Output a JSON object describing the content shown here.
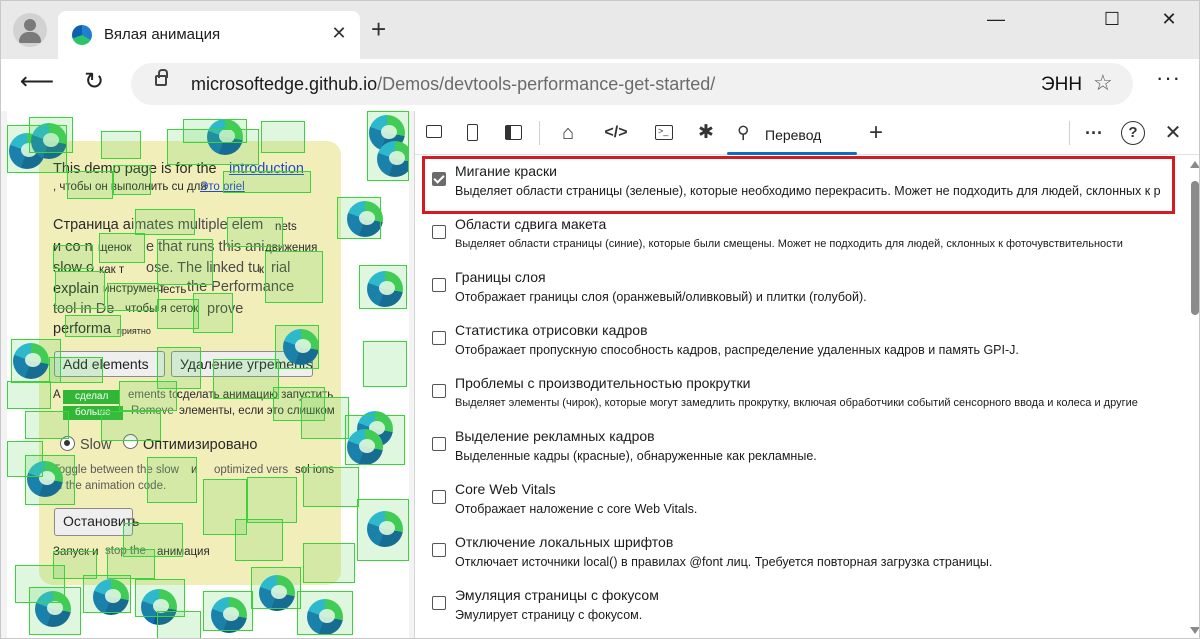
{
  "browser": {
    "tab_title": "Вялая анимация",
    "tab_close": "✕",
    "new_tab": "+",
    "window_controls": {
      "minimize": "—",
      "maximize": "☐",
      "close": "✕"
    },
    "url_host": "microsoftedge.github.io",
    "url_path": "/Demos/devtools-performance-get-started/",
    "read_aloud_label": "ЭНН",
    "favorite_icon": "☆",
    "more_menu": "···",
    "back_icon": "⟵",
    "refresh_icon": "↻"
  },
  "page": {
    "line1a": "This demo page is for the",
    "line1b": "introduction",
    "line2a": ", чтобы он выполнить cu для",
    "line2b": "Это oriel",
    "p1": "Страница a",
    "p1b": "imates multiple elem",
    "p1c": "nets",
    "p2": "и со n",
    "p2b": "щенок",
    "p2c": "e that runs this ani",
    "p2d": "движения",
    "p3": "slow o",
    "p3b": "как т",
    "p3c": "ose. The linked tu",
    "p3d": "к",
    "p3e": "rial",
    "p4": "explain",
    "p4b": "инструмент",
    "p4c": "честь",
    "p4d": "the Performance",
    "p5": "tool in De",
    "p5b": "чтобы я сеток",
    "p5c": "prove",
    "p6": "performa",
    "p6b": "приятно",
    "add_button": "Add elements",
    "remove_button": "Удаление угр",
    "remove_button_tail": "ements",
    "add_label_green": "сделал",
    "more_label_green": "больше",
    "help1a": "A",
    "help1b": "ements to",
    "help1c": "сделать анимацию запустить",
    "help2a": "Remove",
    "help2b": "элементы, если это слишком",
    "radio_slow": "Slow",
    "radio_opt": "Оптимизировано",
    "toggle1": "Toggle between the slow",
    "toggle1b": "и",
    "toggle1c": "optimized vers",
    "toggle1d": "sol ions",
    "toggle2": "of the animation code.",
    "stop_button": "Остановить",
    "footer_a": "Запуск и",
    "footer_b": "stop the",
    "footer_c": "анимация"
  },
  "devtools": {
    "active_tab": "Перевод",
    "add_tab": "+",
    "more_icon": "···",
    "help_icon": "?",
    "close_icon": "✕",
    "options": [
      {
        "title": "Мигание краски",
        "desc": "Выделяет области страницы (зеленые), которые необходимо перекрасить. Может не подходить для людей, склонных к р",
        "checked": true
      },
      {
        "title": "Области сдвига макета",
        "desc": "Выделяет области страницы (синие), которые были смещены. Может не подходить для людей, склонных к фоточувствительности",
        "checked": false
      },
      {
        "title": "Границы слоя",
        "desc": "Отображает границы слоя (оранжевый/оливковый) и плитки (голубой).",
        "checked": false
      },
      {
        "title": "Статистика отрисовки кадров",
        "desc": "Отображает пропускную способность кадров, распределение удаленных кадров и память GPI-J.",
        "checked": false
      },
      {
        "title": "Проблемы с производительностью прокрутки",
        "desc": "Выделяет элементы (чирок), которые могут замедлить прокрутку, включая обработчики событий сенсорного ввода и колеса и другие",
        "checked": false
      },
      {
        "title": "Выделение рекламных кадров",
        "desc": "Выделенные кадры (красные), обнаруженные как рекламные.",
        "checked": false
      },
      {
        "title": "Core Web Vitals",
        "desc": "Отображает наложение с core Web Vitals.",
        "checked": false
      },
      {
        "title": "Отключение локальных шрифтов",
        "desc": "Отключает источники local() в правилах @font лиц. Требуется повторная загрузка страницы.",
        "checked": false
      },
      {
        "title": "Эмуляция страницы с фокусом",
        "desc": "Эмулирует страницу с фокусом.",
        "checked": false
      }
    ]
  }
}
